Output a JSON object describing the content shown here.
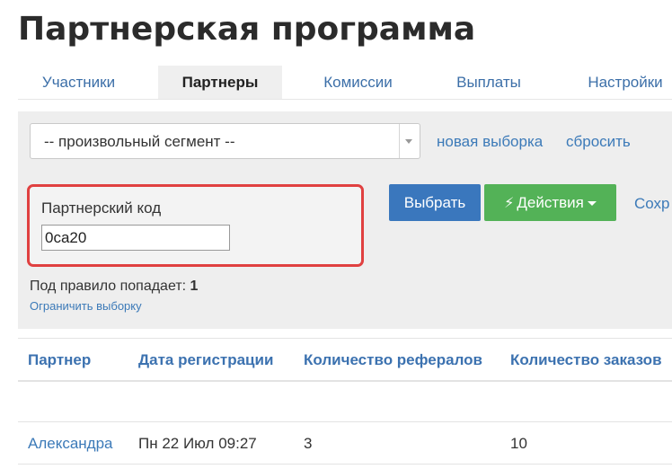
{
  "page_title": "Партнерская программа",
  "tabs": [
    {
      "label": "Участники",
      "active": false
    },
    {
      "label": "Партнеры",
      "active": true
    },
    {
      "label": "Комиссии",
      "active": false
    },
    {
      "label": "Выплаты",
      "active": false
    },
    {
      "label": "Настройки",
      "active": false
    }
  ],
  "filter": {
    "segment_value": "-- произвольный сегмент --",
    "new_selection_link": "новая выборка",
    "reset_link": "сбросить",
    "code_label": "Партнерский код",
    "code_value": "0ca20",
    "select_button": "Выбрать",
    "actions_button": "Действия",
    "save_link": "Сохр",
    "rule_text": "Под правило попадает:",
    "rule_count": "1",
    "limit_link": "Ограничить выборку"
  },
  "table": {
    "headers": [
      "Партнер",
      "Дата регистрации",
      "Количество рефералов",
      "Количество заказов"
    ],
    "rows": [
      [
        "Александра",
        "Пн 22 Июл 09:27",
        "3",
        "10"
      ]
    ]
  },
  "colors": {
    "accent_blue": "#3a77bd",
    "action_green": "#53b257",
    "highlight_red": "#e04040"
  },
  "icons": {
    "actions": "bolt-icon",
    "dropdown": "caret-down-icon"
  }
}
